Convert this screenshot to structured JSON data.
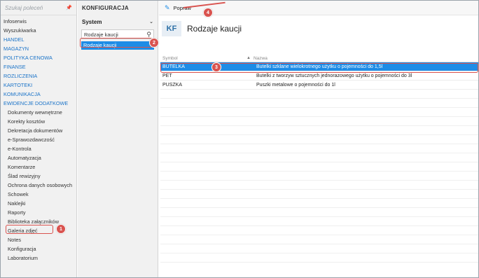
{
  "left_nav": {
    "search_placeholder": "Szukaj poleceń",
    "items": [
      {
        "label": "Infoserwis",
        "type": "plain"
      },
      {
        "label": "Wyszukiwarka",
        "type": "plain"
      },
      {
        "label": "HANDEL",
        "type": "section"
      },
      {
        "label": "MAGAZYN",
        "type": "section"
      },
      {
        "label": "POLITYKA CENOWA",
        "type": "section"
      },
      {
        "label": "FINANSE",
        "type": "section"
      },
      {
        "label": "ROZLICZENIA",
        "type": "section"
      },
      {
        "label": "KARTOTEKI",
        "type": "section"
      },
      {
        "label": "KOMUNIKACJA",
        "type": "section"
      },
      {
        "label": "EWIDENCJE DODATKOWE",
        "type": "section"
      },
      {
        "label": "Dokumenty wewnętrzne",
        "type": "sub"
      },
      {
        "label": "Korekty kosztów",
        "type": "sub"
      },
      {
        "label": "Dekretacja dokumentów",
        "type": "sub"
      },
      {
        "label": "e-Sprawozdawczość",
        "type": "sub"
      },
      {
        "label": "e-Kontrola",
        "type": "sub"
      },
      {
        "label": "Automatyzacja",
        "type": "sub"
      },
      {
        "label": "Komentarze",
        "type": "sub"
      },
      {
        "label": "Ślad rewizyjny",
        "type": "sub"
      },
      {
        "label": "Ochrona danych osobowych",
        "type": "sub"
      },
      {
        "label": "Schowek",
        "type": "sub"
      },
      {
        "label": "Naklejki",
        "type": "sub"
      },
      {
        "label": "Raporty",
        "type": "sub"
      },
      {
        "label": "Biblioteka załączników",
        "type": "sub"
      },
      {
        "label": "Galeria zdjęć",
        "type": "sub"
      },
      {
        "label": "Notes",
        "type": "sub"
      },
      {
        "label": "Konfiguracja",
        "type": "sub"
      },
      {
        "label": "Laboratorium",
        "type": "sub"
      }
    ]
  },
  "middle": {
    "title": "KONFIGURACJA",
    "selector": "System",
    "search_value": "Rodzaje kaucji",
    "selected_item": "Rodzaje kaucji"
  },
  "toolbar": {
    "edit_label": "Popraw"
  },
  "header": {
    "badge": "KF",
    "title": "Rodzaje kaucji"
  },
  "table": {
    "col_symbol": "Symbol",
    "col_name": "Nazwa",
    "rows": [
      {
        "symbol": "BUTELKA",
        "name": "Butelki szklane wielokrotnego użytku o pojemności do 1,5l",
        "selected": true
      },
      {
        "symbol": "PET",
        "name": "Butelki z tworzyw sztucznych jednorazowego użytku o pojemności do 3l",
        "selected": false
      },
      {
        "symbol": "PUSZKA",
        "name": "Puszki metalowe o pojemności do 1l",
        "selected": false
      }
    ]
  },
  "markers": [
    "1",
    "2",
    "3",
    "4"
  ],
  "colors": {
    "accent": "#1e8ce6",
    "section_link": "#1a73c8",
    "annotation": "#d9534f"
  }
}
